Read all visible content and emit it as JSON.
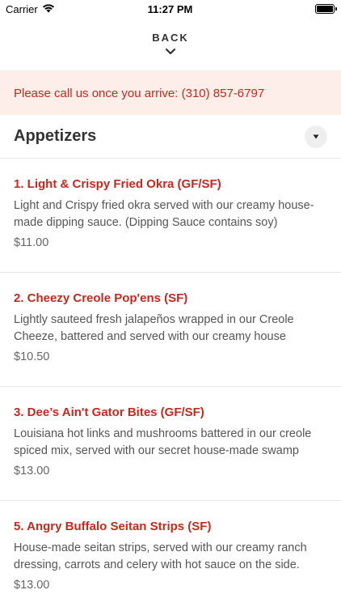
{
  "status_bar": {
    "carrier": "Carrier",
    "time": "11:27 PM",
    "icons": [
      "wifi-icon",
      "battery-icon"
    ]
  },
  "header": {
    "back_label": "BACK",
    "icon": "chevron-down-icon"
  },
  "notice": {
    "text": "Please call us once you arrive: (310) 857-6797",
    "color": "#c6281c",
    "background": "#fdeee9"
  },
  "section": {
    "title": "Appetizers",
    "icon": "caret-down-icon"
  },
  "items": [
    {
      "name": "1. Light & Crispy Fried Okra (GF/SF)",
      "description": "Light and Crispy fried okra served with our creamy house-made dipping sauce. (Dipping Sauce contains soy)",
      "price": "$11.00"
    },
    {
      "name": "2. Cheezy Creole Pop'ens (SF)",
      "description": "Lightly sauteed fresh jalapeños wrapped in our Creole Cheeze, battered and served with our creamy house",
      "price": "$10.50"
    },
    {
      "name": "3. Dee’s Ain't Gator Bites (GF/SF)",
      "description": "Louisiana hot links and mushrooms battered in our creole spiced mix, served with our secret house-made swamp",
      "price": "$13.00"
    },
    {
      "name": "5. Angry Buffalo Seitan Strips (SF)",
      "description": "House-made seitan strips, served with our creamy ranch dressing, carrots and celery with hot sauce on the side.",
      "price": "$13.00"
    }
  ],
  "colors": {
    "accent": "#c6281c",
    "text": "#555555"
  }
}
